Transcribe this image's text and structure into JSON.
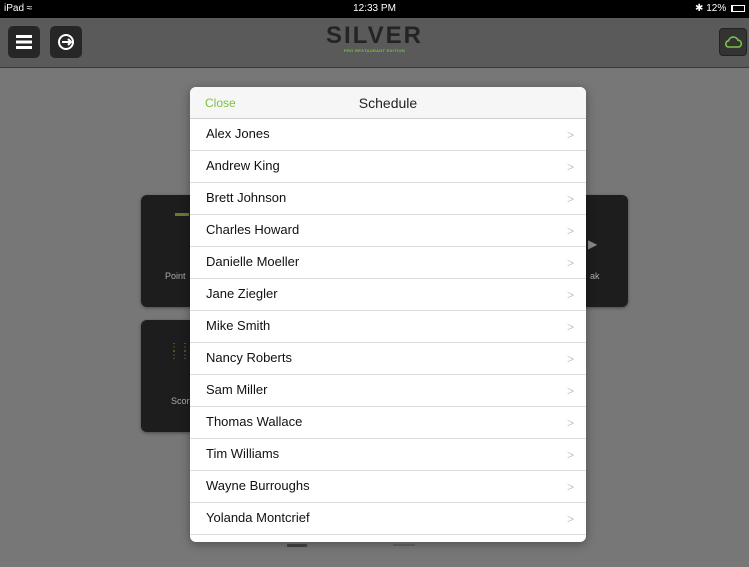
{
  "statusbar": {
    "device": "iPad",
    "time": "12:33 PM",
    "battery": "12%"
  },
  "navbar": {
    "logo_text": "SILVER",
    "logo_subtext": "PRO RESTAURANT EDITION"
  },
  "background_tiles": {
    "tile1_label": "Point",
    "tile2_label": "ak",
    "tile3_label": "Scor"
  },
  "modal": {
    "close_label": "Close",
    "title": "Schedule",
    "items": [
      {
        "label": "Alex Jones"
      },
      {
        "label": "Andrew King"
      },
      {
        "label": "Brett Johnson"
      },
      {
        "label": "Charles Howard"
      },
      {
        "label": "Danielle Moeller"
      },
      {
        "label": "Jane Ziegler"
      },
      {
        "label": "Mike Smith"
      },
      {
        "label": "Nancy Roberts"
      },
      {
        "label": "Sam Miller"
      },
      {
        "label": "Thomas Wallace"
      },
      {
        "label": "Tim Williams"
      },
      {
        "label": "Wayne Burroughs"
      },
      {
        "label": "Yolanda Montcrief"
      }
    ]
  },
  "colors": {
    "accent_green": "#7cc142"
  }
}
